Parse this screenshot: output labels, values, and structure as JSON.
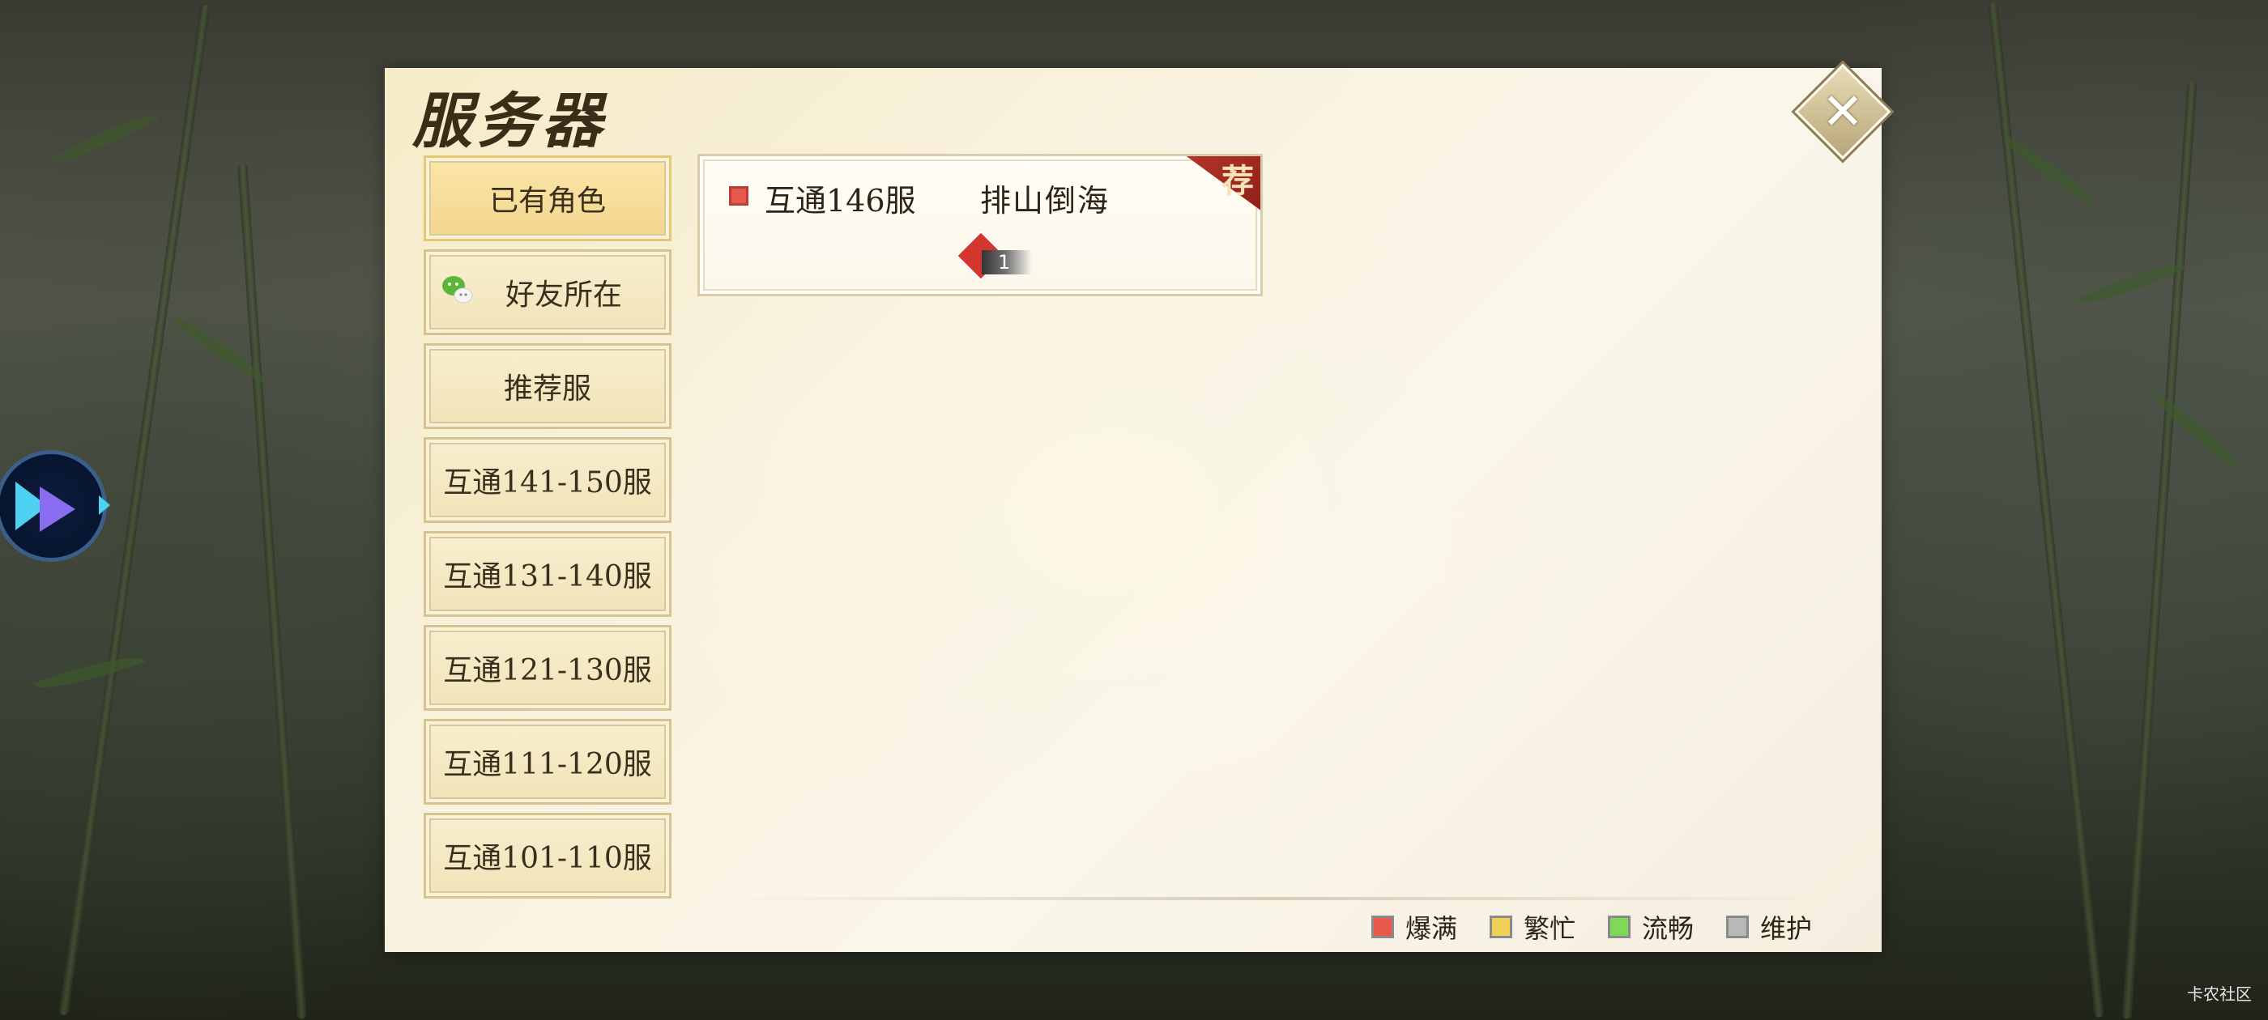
{
  "dialog": {
    "title": "服务器",
    "close_icon": "close-icon"
  },
  "side_nav": {
    "items": [
      {
        "label": "已有角色",
        "active": true
      },
      {
        "label": "好友所在",
        "icon": "wechat-icon"
      },
      {
        "label": "推荐服"
      },
      {
        "label": "互通141-150服"
      },
      {
        "label": "互通131-140服"
      },
      {
        "label": "互通121-130服"
      },
      {
        "label": "互通111-120服"
      },
      {
        "label": "互通101-110服"
      }
    ]
  },
  "servers": [
    {
      "name": "互通146服",
      "role": "排山倒海",
      "status": "爆满",
      "status_color": "#e8584c",
      "tag": "荐",
      "badge_icon": "flame-icon",
      "badge_count": "1"
    }
  ],
  "legend": [
    {
      "label": "爆满",
      "color": "#e8584c"
    },
    {
      "label": "繁忙",
      "color": "#f2cf55"
    },
    {
      "label": "流畅",
      "color": "#7ed957"
    },
    {
      "label": "维护",
      "color": "#b9b9b9"
    }
  ],
  "overlay": {
    "float_ball_icon": "floating-assistant-icon",
    "watermark": "卡农社区"
  }
}
